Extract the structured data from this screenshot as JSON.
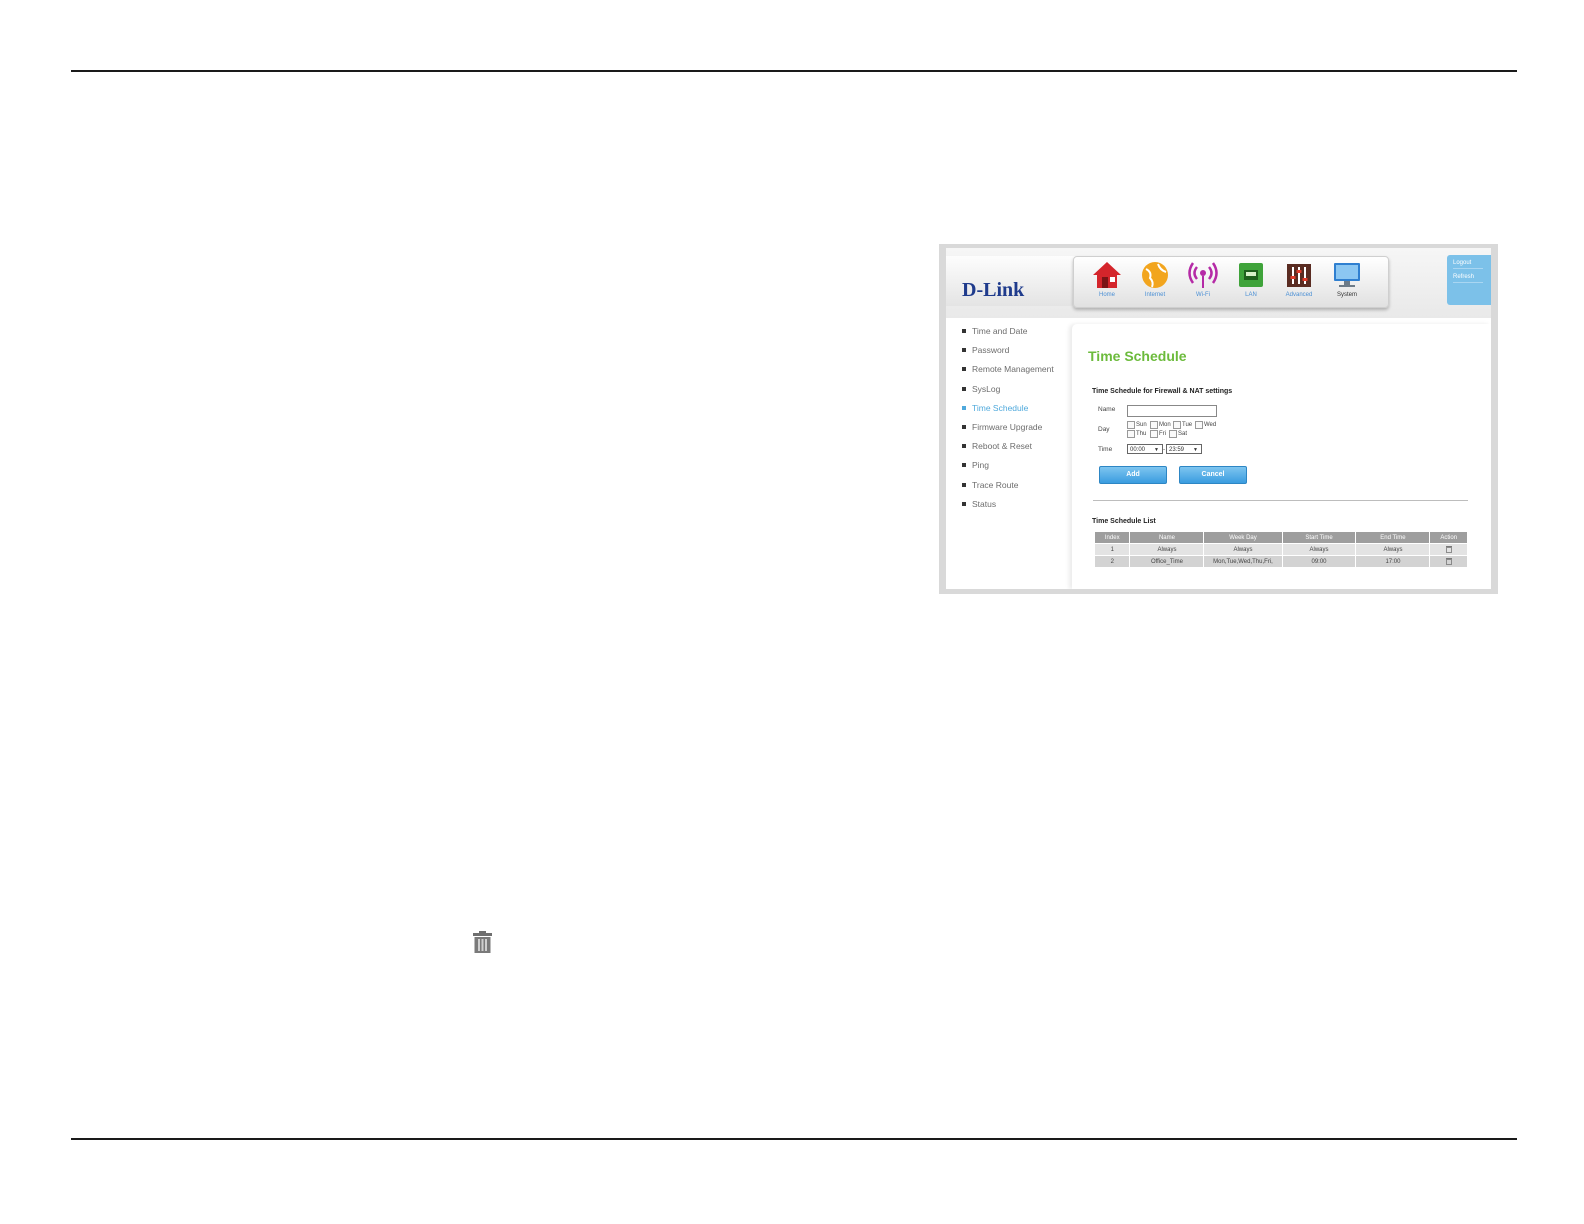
{
  "trash_icon_large": "trash-icon",
  "router_ui": {
    "logo": "D-Link",
    "nav": [
      {
        "label": "Home",
        "icon": "home-icon"
      },
      {
        "label": "Internet",
        "icon": "globe-icon"
      },
      {
        "label": "Wi-Fi",
        "icon": "wifi-icon"
      },
      {
        "label": "LAN",
        "icon": "lan-icon"
      },
      {
        "label": "Advanced",
        "icon": "advanced-icon"
      },
      {
        "label": "System",
        "icon": "monitor-icon"
      }
    ],
    "side_buttons": {
      "logout": "Logout",
      "refresh": "Refresh"
    },
    "menu": [
      "Time and Date",
      "Password",
      "Remote Management",
      "SysLog",
      "Time Schedule",
      "Firmware Upgrade",
      "Reboot & Reset",
      "Ping",
      "Trace Route",
      "Status"
    ],
    "active_menu": "Time Schedule",
    "page_title": "Time Schedule",
    "form": {
      "section_title": "Time Schedule for Firewall & NAT settings",
      "name_label": "Name",
      "name_value": "",
      "day_label": "Day",
      "days": [
        "Sun",
        "Mon",
        "Tue",
        "Wed",
        "Thu",
        "Fri",
        "Sat"
      ],
      "time_label": "Time",
      "start_time": "00:00",
      "end_time": "23:59",
      "time_separator": "-",
      "add_label": "Add",
      "cancel_label": "Cancel"
    },
    "list": {
      "title": "Time Schedule List",
      "headers": [
        "Index",
        "Name",
        "Week Day",
        "Start Time",
        "End Time",
        "Action"
      ],
      "rows": [
        [
          "1",
          "Always",
          "Always",
          "Always",
          "Always"
        ],
        [
          "2",
          "Office_Time",
          "Mon,Tue,Wed,Thu,Fri,",
          "09:00",
          "17:00"
        ]
      ]
    }
  }
}
